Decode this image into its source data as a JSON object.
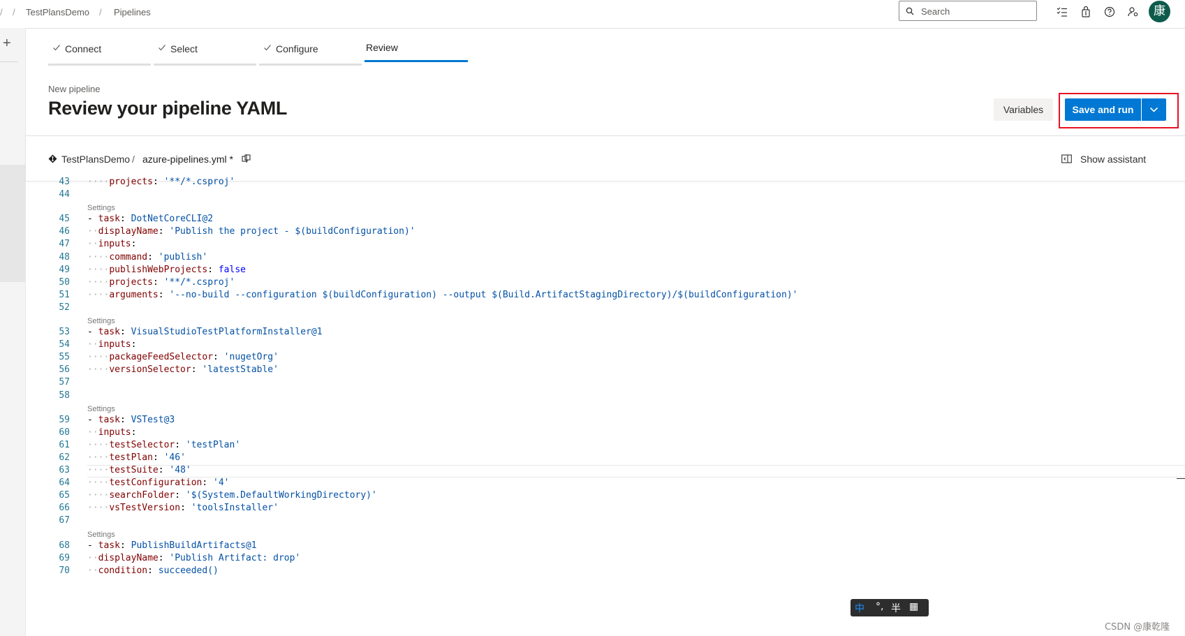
{
  "breadcrumb": {
    "project": "TestPlansDemo",
    "section": "Pipelines"
  },
  "search": {
    "placeholder": "Search"
  },
  "user": {
    "avatar_text": "康"
  },
  "wizard": {
    "steps": [
      {
        "label": "Connect",
        "state": "done"
      },
      {
        "label": "Select",
        "state": "done"
      },
      {
        "label": "Configure",
        "state": "done"
      },
      {
        "label": "Review",
        "state": "active"
      }
    ]
  },
  "page": {
    "kicker": "New pipeline",
    "title": "Review your pipeline YAML"
  },
  "actions": {
    "variables_label": "Variables",
    "save_label": "Save and run"
  },
  "file": {
    "repo": "TestPlansDemo",
    "separator": "/",
    "filename": "azure-pipelines.yml *",
    "assistant_label": "Show assistant"
  },
  "editor": {
    "codelens_label": "Settings",
    "lines": [
      {
        "n": "43",
        "text": "    projects: '**/*.csproj'"
      },
      {
        "n": "44",
        "text": ""
      },
      {
        "n": "45",
        "text": "- task: DotNetCoreCLI@2",
        "lens": true
      },
      {
        "n": "46",
        "text": "  displayName: 'Publish the project - $(buildConfiguration)'"
      },
      {
        "n": "47",
        "text": "  inputs:"
      },
      {
        "n": "48",
        "text": "    command: 'publish'"
      },
      {
        "n": "49",
        "text": "    publishWebProjects: false"
      },
      {
        "n": "50",
        "text": "    projects: '**/*.csproj'"
      },
      {
        "n": "51",
        "text": "    arguments: '--no-build --configuration $(buildConfiguration) --output $(Build.ArtifactStagingDirectory)/$(buildConfiguration)'"
      },
      {
        "n": "52",
        "text": ""
      },
      {
        "n": "53",
        "text": "- task: VisualStudioTestPlatformInstaller@1",
        "lens": true
      },
      {
        "n": "54",
        "text": "  inputs:"
      },
      {
        "n": "55",
        "text": "    packageFeedSelector: 'nugetOrg'"
      },
      {
        "n": "56",
        "text": "    versionSelector: 'latestStable'"
      },
      {
        "n": "57",
        "text": ""
      },
      {
        "n": "58",
        "text": ""
      },
      {
        "n": "59",
        "text": "- task: VSTest@3",
        "lens": true
      },
      {
        "n": "60",
        "text": "  inputs:"
      },
      {
        "n": "61",
        "text": "    testSelector: 'testPlan'"
      },
      {
        "n": "62",
        "text": "    testPlan: '46'"
      },
      {
        "n": "63",
        "text": "    testSuite: '48'"
      },
      {
        "n": "64",
        "text": "    testConfiguration: '4'"
      },
      {
        "n": "65",
        "text": "    searchFolder: '$(System.DefaultWorkingDirectory)'"
      },
      {
        "n": "66",
        "text": "    vsTestVersion: 'toolsInstaller'"
      },
      {
        "n": "67",
        "text": ""
      },
      {
        "n": "68",
        "text": "- task: PublishBuildArtifacts@1",
        "lens": true
      },
      {
        "n": "69",
        "text": "  displayName: 'Publish Artifact: drop'"
      },
      {
        "n": "70",
        "text": "  condition: succeeded()"
      }
    ]
  },
  "ime": {
    "mode": "中",
    "punct": "°,",
    "width": "半"
  },
  "watermark": "CSDN @康乾隆",
  "colors": {
    "accent": "#0078d4",
    "highlight_box": "#e81123",
    "avatar_bg": "#0e5b4c"
  }
}
